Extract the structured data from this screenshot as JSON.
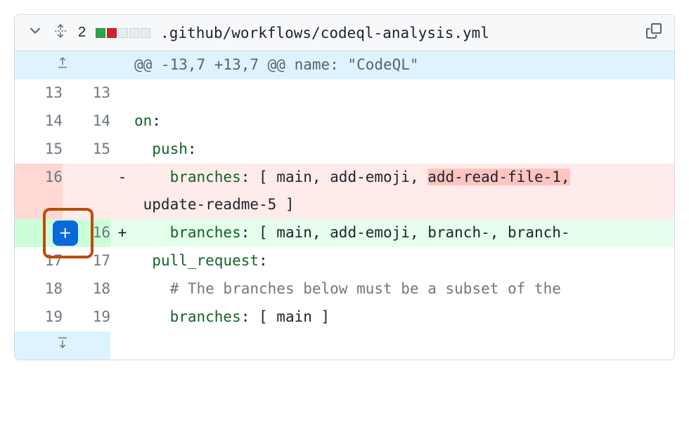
{
  "header": {
    "change_count": "2",
    "file_path": ".github/workflows/codeql-analysis.yml"
  },
  "hunk": {
    "text": "@@ -13,7 +13,7 @@ name: \"CodeQL\""
  },
  "lines": [
    {
      "old": "13",
      "new": "13",
      "type": "ctx",
      "prefix": " ",
      "text": ""
    },
    {
      "old": "14",
      "new": "14",
      "type": "ctx",
      "prefix": " ",
      "key": "on",
      "rest": ":"
    },
    {
      "old": "15",
      "new": "15",
      "type": "ctx",
      "prefix": " ",
      "indent": "  ",
      "key": "push",
      "rest": ":"
    },
    {
      "old": "16",
      "new": "",
      "type": "del",
      "prefix": "-",
      "indent": "    ",
      "key": "branches",
      "rest": ": [ main, add-emoji, ",
      "removed": "add-read-file-1,",
      "wrap": " update-readme-5 ]"
    },
    {
      "old": "",
      "new": "16",
      "type": "add",
      "prefix": "+",
      "indent": "    ",
      "key": "branches",
      "rest": ": [ main, add-emoji, branch-, branch-"
    },
    {
      "old": "17",
      "new": "17",
      "type": "ctx",
      "prefix": " ",
      "indent": "  ",
      "key": "pull_request",
      "rest": ":"
    },
    {
      "old": "18",
      "new": "18",
      "type": "ctx",
      "prefix": " ",
      "indent": "    ",
      "comment": "# The branches below must be a subset of the "
    },
    {
      "old": "19",
      "new": "19",
      "type": "ctx",
      "prefix": " ",
      "indent": "    ",
      "key": "branches",
      "rest": ": [ main ]"
    }
  ]
}
